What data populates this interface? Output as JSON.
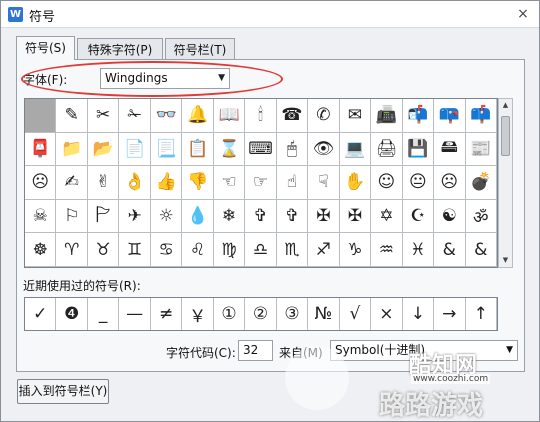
{
  "window": {
    "title": "符号",
    "app_icon": "W",
    "close": "×"
  },
  "tabs": [
    {
      "label": "符号(S)",
      "active": true
    },
    {
      "label": "特殊字符(P)",
      "active": false
    },
    {
      "label": "符号栏(T)",
      "active": false
    }
  ],
  "font": {
    "label": "字体(F):",
    "value": "Wingdings"
  },
  "symbols": [
    "",
    "✎",
    "✂",
    "✁",
    "👓",
    "🔔",
    "📖",
    "🕯",
    "☎",
    "✆",
    "✉",
    "📠",
    "📬",
    "📪",
    "📫",
    "📮",
    "📁",
    "📂",
    "📄",
    "📃",
    "📋",
    "⌛",
    "⌨",
    "🖱",
    "👁",
    "💻",
    "🖨",
    "💾",
    "🖴",
    "📰",
    "☹",
    "✍",
    "✌",
    "👌",
    "👍",
    "👎",
    "☜",
    "☞",
    "☝",
    "☟",
    "✋",
    "☺",
    "😐",
    "☹",
    "💣",
    "☠",
    "⚐",
    "🏱",
    "✈",
    "☼",
    "💧",
    "❄",
    "✞",
    "✞",
    "✠",
    "✠",
    "✡",
    "☪",
    "☯",
    "ॐ",
    "☸",
    "♈",
    "♉",
    "♊",
    "♋",
    "♌",
    "♍",
    "♎",
    "♏",
    "♐",
    "♑",
    "♒",
    "♓",
    "&",
    "&"
  ],
  "recent": {
    "label": "近期使用过的符号(R):",
    "items": [
      "✓",
      "❹",
      "_",
      "—",
      "≠",
      "￥",
      "①",
      "②",
      "③",
      "№",
      "√",
      "×",
      "↓",
      "→",
      "↑"
    ]
  },
  "code": {
    "label": "字符代码(C):",
    "value": "32"
  },
  "from": {
    "label": "来自(M)",
    "value": "Symbol(十进制)"
  },
  "buttons": {
    "insert": "插入到符号栏(Y)"
  },
  "watermark": {
    "brand": "酷知网",
    "url": "www.coozhi.com",
    "sub": "路路游戏"
  },
  "colors": {
    "highlight": "#e03a36",
    "selected_cell": "#a9a9a9"
  }
}
